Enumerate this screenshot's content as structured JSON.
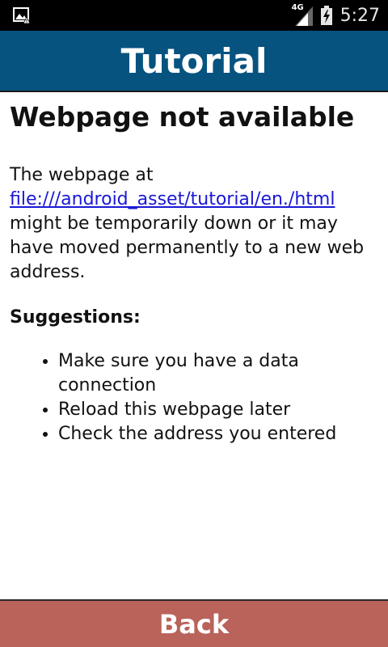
{
  "status_bar": {
    "network_type": "4G",
    "time": "5:27",
    "icons": [
      "image-notification-icon",
      "signal-icon",
      "battery-charging-icon"
    ]
  },
  "header": {
    "title": "Tutorial",
    "color": "#07537f"
  },
  "error_page": {
    "heading": "Webpage not available",
    "intro": "The webpage at",
    "url": "file:///android_asset/tutorial/en./html",
    "message": "might be temporarily down or it may have moved permanently to a new web address.",
    "suggestions_heading": "Suggestions:",
    "suggestions": [
      "Make sure you have a data connection",
      "Reload this webpage later",
      "Check the address you entered"
    ]
  },
  "footer": {
    "back_label": "Back",
    "color": "#b9635b"
  }
}
